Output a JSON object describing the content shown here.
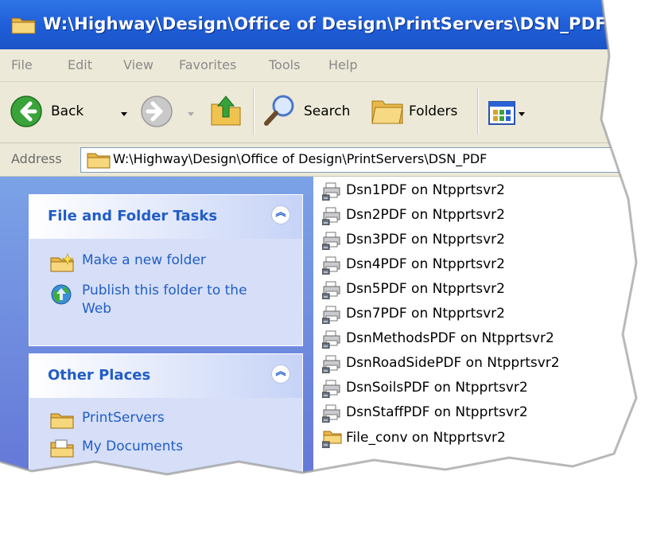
{
  "window": {
    "title": "W:\\Highway\\Design\\Office of Design\\PrintServers\\DSN_PDF"
  },
  "menu": [
    "File",
    "Edit",
    "View",
    "Favorites",
    "Tools",
    "Help"
  ],
  "toolbar": {
    "back_label": "Back",
    "search_label": "Search",
    "folders_label": "Folders"
  },
  "address": {
    "label": "Address",
    "value": "W:\\Highway\\Design\\Office of Design\\PrintServers\\DSN_PDF"
  },
  "tasks_panel": {
    "title": "File and Folder Tasks",
    "items": [
      {
        "label": "Make a new folder",
        "icon": "new-folder-icon"
      },
      {
        "label": "Publish this folder to the",
        "label2": "Web",
        "icon": "publish-web-icon"
      }
    ]
  },
  "places_panel": {
    "title": "Other Places",
    "items": [
      {
        "label": "PrintServers",
        "icon": "folder-icon"
      },
      {
        "label": "My Documents",
        "icon": "documents-icon"
      }
    ]
  },
  "files": [
    {
      "name": "Dsn1PDF on Ntpprtsvr2",
      "icon": "network-printer-icon"
    },
    {
      "name": "Dsn2PDF on Ntpprtsvr2",
      "icon": "network-printer-icon"
    },
    {
      "name": "Dsn3PDF on Ntpprtsvr2",
      "icon": "network-printer-icon"
    },
    {
      "name": "Dsn4PDF on Ntpprtsvr2",
      "icon": "network-printer-icon"
    },
    {
      "name": "Dsn5PDF on Ntpprtsvr2",
      "icon": "network-printer-icon"
    },
    {
      "name": "Dsn7PDF on Ntpprtsvr2",
      "icon": "network-printer-icon"
    },
    {
      "name": "DsnMethodsPDF on Ntpprtsvr2",
      "icon": "network-printer-icon"
    },
    {
      "name": "DsnRoadSidePDF on Ntpprtsvr2",
      "icon": "network-printer-icon"
    },
    {
      "name": "DsnSoilsPDF on Ntpprtsvr2",
      "icon": "network-printer-icon"
    },
    {
      "name": "DsnStaffPDF on Ntpprtsvr2",
      "icon": "network-printer-icon"
    },
    {
      "name": "File_conv on Ntpprtsvr2",
      "icon": "network-folder-icon"
    }
  ],
  "colors": {
    "titlebar": "#1f5fd9",
    "taskpane": "#6f8fe0",
    "link": "#215dc6"
  }
}
